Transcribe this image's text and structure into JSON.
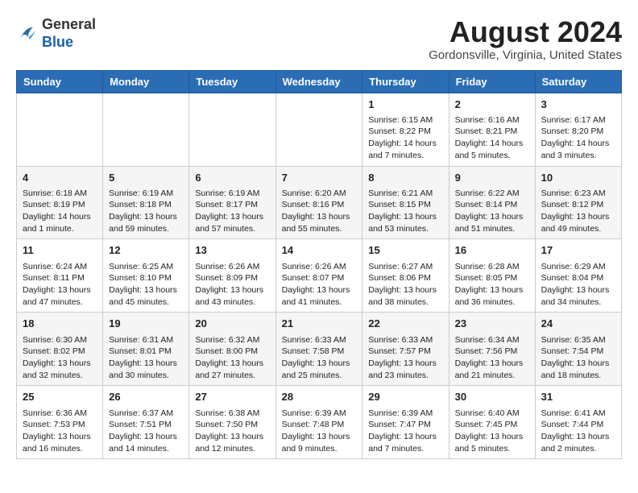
{
  "header": {
    "logo_line1": "General",
    "logo_line2": "Blue",
    "month_year": "August 2024",
    "location": "Gordonsville, Virginia, United States"
  },
  "days_of_week": [
    "Sunday",
    "Monday",
    "Tuesday",
    "Wednesday",
    "Thursday",
    "Friday",
    "Saturday"
  ],
  "weeks": [
    [
      {
        "day": "",
        "info": ""
      },
      {
        "day": "",
        "info": ""
      },
      {
        "day": "",
        "info": ""
      },
      {
        "day": "",
        "info": ""
      },
      {
        "day": "1",
        "info": "Sunrise: 6:15 AM\nSunset: 8:22 PM\nDaylight: 14 hours\nand 7 minutes."
      },
      {
        "day": "2",
        "info": "Sunrise: 6:16 AM\nSunset: 8:21 PM\nDaylight: 14 hours\nand 5 minutes."
      },
      {
        "day": "3",
        "info": "Sunrise: 6:17 AM\nSunset: 8:20 PM\nDaylight: 14 hours\nand 3 minutes."
      }
    ],
    [
      {
        "day": "4",
        "info": "Sunrise: 6:18 AM\nSunset: 8:19 PM\nDaylight: 14 hours\nand 1 minute."
      },
      {
        "day": "5",
        "info": "Sunrise: 6:19 AM\nSunset: 8:18 PM\nDaylight: 13 hours\nand 59 minutes."
      },
      {
        "day": "6",
        "info": "Sunrise: 6:19 AM\nSunset: 8:17 PM\nDaylight: 13 hours\nand 57 minutes."
      },
      {
        "day": "7",
        "info": "Sunrise: 6:20 AM\nSunset: 8:16 PM\nDaylight: 13 hours\nand 55 minutes."
      },
      {
        "day": "8",
        "info": "Sunrise: 6:21 AM\nSunset: 8:15 PM\nDaylight: 13 hours\nand 53 minutes."
      },
      {
        "day": "9",
        "info": "Sunrise: 6:22 AM\nSunset: 8:14 PM\nDaylight: 13 hours\nand 51 minutes."
      },
      {
        "day": "10",
        "info": "Sunrise: 6:23 AM\nSunset: 8:12 PM\nDaylight: 13 hours\nand 49 minutes."
      }
    ],
    [
      {
        "day": "11",
        "info": "Sunrise: 6:24 AM\nSunset: 8:11 PM\nDaylight: 13 hours\nand 47 minutes."
      },
      {
        "day": "12",
        "info": "Sunrise: 6:25 AM\nSunset: 8:10 PM\nDaylight: 13 hours\nand 45 minutes."
      },
      {
        "day": "13",
        "info": "Sunrise: 6:26 AM\nSunset: 8:09 PM\nDaylight: 13 hours\nand 43 minutes."
      },
      {
        "day": "14",
        "info": "Sunrise: 6:26 AM\nSunset: 8:07 PM\nDaylight: 13 hours\nand 41 minutes."
      },
      {
        "day": "15",
        "info": "Sunrise: 6:27 AM\nSunset: 8:06 PM\nDaylight: 13 hours\nand 38 minutes."
      },
      {
        "day": "16",
        "info": "Sunrise: 6:28 AM\nSunset: 8:05 PM\nDaylight: 13 hours\nand 36 minutes."
      },
      {
        "day": "17",
        "info": "Sunrise: 6:29 AM\nSunset: 8:04 PM\nDaylight: 13 hours\nand 34 minutes."
      }
    ],
    [
      {
        "day": "18",
        "info": "Sunrise: 6:30 AM\nSunset: 8:02 PM\nDaylight: 13 hours\nand 32 minutes."
      },
      {
        "day": "19",
        "info": "Sunrise: 6:31 AM\nSunset: 8:01 PM\nDaylight: 13 hours\nand 30 minutes."
      },
      {
        "day": "20",
        "info": "Sunrise: 6:32 AM\nSunset: 8:00 PM\nDaylight: 13 hours\nand 27 minutes."
      },
      {
        "day": "21",
        "info": "Sunrise: 6:33 AM\nSunset: 7:58 PM\nDaylight: 13 hours\nand 25 minutes."
      },
      {
        "day": "22",
        "info": "Sunrise: 6:33 AM\nSunset: 7:57 PM\nDaylight: 13 hours\nand 23 minutes."
      },
      {
        "day": "23",
        "info": "Sunrise: 6:34 AM\nSunset: 7:56 PM\nDaylight: 13 hours\nand 21 minutes."
      },
      {
        "day": "24",
        "info": "Sunrise: 6:35 AM\nSunset: 7:54 PM\nDaylight: 13 hours\nand 18 minutes."
      }
    ],
    [
      {
        "day": "25",
        "info": "Sunrise: 6:36 AM\nSunset: 7:53 PM\nDaylight: 13 hours\nand 16 minutes."
      },
      {
        "day": "26",
        "info": "Sunrise: 6:37 AM\nSunset: 7:51 PM\nDaylight: 13 hours\nand 14 minutes."
      },
      {
        "day": "27",
        "info": "Sunrise: 6:38 AM\nSunset: 7:50 PM\nDaylight: 13 hours\nand 12 minutes."
      },
      {
        "day": "28",
        "info": "Sunrise: 6:39 AM\nSunset: 7:48 PM\nDaylight: 13 hours\nand 9 minutes."
      },
      {
        "day": "29",
        "info": "Sunrise: 6:39 AM\nSunset: 7:47 PM\nDaylight: 13 hours\nand 7 minutes."
      },
      {
        "day": "30",
        "info": "Sunrise: 6:40 AM\nSunset: 7:45 PM\nDaylight: 13 hours\nand 5 minutes."
      },
      {
        "day": "31",
        "info": "Sunrise: 6:41 AM\nSunset: 7:44 PM\nDaylight: 13 hours\nand 2 minutes."
      }
    ]
  ]
}
